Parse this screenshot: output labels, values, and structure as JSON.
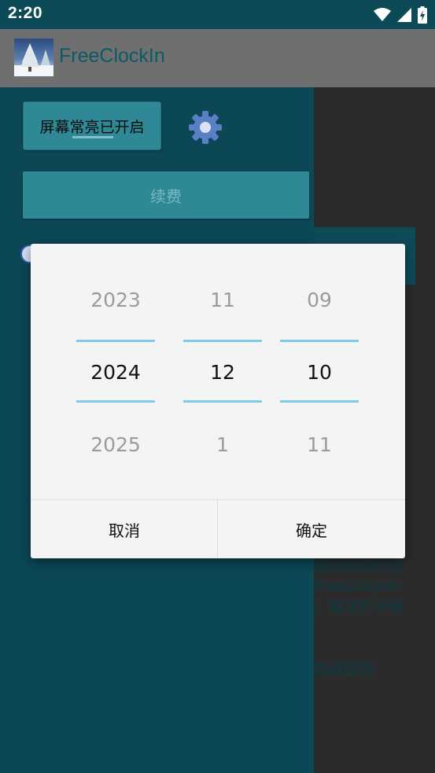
{
  "status_bar": {
    "time": "2:20",
    "icons": [
      "wifi-icon",
      "signal-icon",
      "battery-icon"
    ]
  },
  "app_bar": {
    "title": "FreeClockIn",
    "logo": "app-logo-icon"
  },
  "drawer": {
    "screen_toggle_label": "屏幕常亮已开启",
    "settings_icon": "gear-icon",
    "renew_label": "续费",
    "clock_icon": "clock-icon"
  },
  "background_content": {
    "text_lines": "案指纹密码也\nFreeClockIn\n；每次打卡闹",
    "text_tail": "动返回到"
  },
  "date_picker": {
    "year": {
      "prev": "2023",
      "current": "2024",
      "next": "2025"
    },
    "month": {
      "prev": "11",
      "current": "12",
      "next": "1"
    },
    "day": {
      "prev": "09",
      "current": "10",
      "next": "11"
    },
    "cancel_label": "取消",
    "confirm_label": "确定"
  },
  "colors": {
    "drawer_bg": "#0b4754",
    "accent_button": "#2f8896",
    "selection_line": "#7fcbe8",
    "dialog_bg": "#f4f4f4"
  }
}
